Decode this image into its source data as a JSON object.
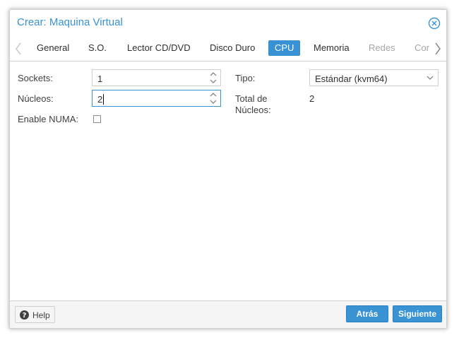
{
  "window": {
    "title": "Crear: Maquina Virtual",
    "close_icon": "close-circle-icon"
  },
  "tabs": [
    {
      "label": "General",
      "state": "normal"
    },
    {
      "label": "S.O.",
      "state": "normal"
    },
    {
      "label": "Lector CD/DVD",
      "state": "normal"
    },
    {
      "label": "Disco Duro",
      "state": "normal"
    },
    {
      "label": "CPU",
      "state": "active"
    },
    {
      "label": "Memoria",
      "state": "normal"
    },
    {
      "label": "Redes",
      "state": "disabled"
    },
    {
      "label": "Cor",
      "state": "disabled"
    }
  ],
  "form": {
    "sockets": {
      "label": "Sockets:",
      "value": "1"
    },
    "nucleos": {
      "label": "Núcleos:",
      "value": "2"
    },
    "numa": {
      "label": "Enable NUMA:",
      "checked": false
    },
    "tipo": {
      "label": "Tipo:",
      "value": "Estándar (kvm64)"
    },
    "total": {
      "label_line1": "Total de",
      "label_line2": "Núcleos:",
      "value": "2"
    }
  },
  "footer": {
    "help_label": "Help",
    "back_label": "Atrás",
    "next_label": "Siguiente"
  },
  "colors": {
    "accent": "#3892d4",
    "disabled_text": "#a6a6a6",
    "footer_bg": "#f5f5f5"
  }
}
